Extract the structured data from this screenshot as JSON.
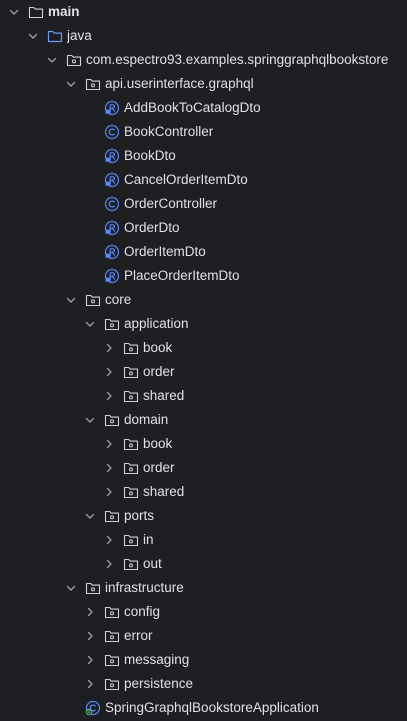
{
  "project_tree": {
    "nodes": [
      {
        "label": "main",
        "kind": "folder-plain",
        "state": "expanded",
        "bold": true,
        "depth": 0
      },
      {
        "label": "java",
        "kind": "folder-source",
        "state": "expanded",
        "depth": 1
      },
      {
        "label": "com.espectro93.examples.springgraphqlbookstore",
        "kind": "package",
        "state": "expanded",
        "depth": 2
      },
      {
        "label": "api.userinterface.graphql",
        "kind": "package",
        "state": "expanded",
        "depth": 3
      },
      {
        "label": "AddBookToCatalogDto",
        "kind": "record",
        "state": "leaf",
        "depth": 4
      },
      {
        "label": "BookController",
        "kind": "class",
        "state": "leaf",
        "depth": 4
      },
      {
        "label": "BookDto",
        "kind": "record",
        "state": "leaf",
        "depth": 4
      },
      {
        "label": "CancelOrderItemDto",
        "kind": "record",
        "state": "leaf",
        "depth": 4
      },
      {
        "label": "OrderController",
        "kind": "class",
        "state": "leaf",
        "depth": 4
      },
      {
        "label": "OrderDto",
        "kind": "record",
        "state": "leaf",
        "depth": 4
      },
      {
        "label": "OrderItemDto",
        "kind": "record",
        "state": "leaf",
        "depth": 4
      },
      {
        "label": "PlaceOrderItemDto",
        "kind": "record",
        "state": "leaf",
        "depth": 4
      },
      {
        "label": "core",
        "kind": "package",
        "state": "expanded",
        "depth": 3
      },
      {
        "label": "application",
        "kind": "package",
        "state": "expanded",
        "depth": 4
      },
      {
        "label": "book",
        "kind": "package",
        "state": "collapsed",
        "depth": 5
      },
      {
        "label": "order",
        "kind": "package",
        "state": "collapsed",
        "depth": 5
      },
      {
        "label": "shared",
        "kind": "package",
        "state": "collapsed",
        "depth": 5
      },
      {
        "label": "domain",
        "kind": "package",
        "state": "expanded",
        "depth": 4
      },
      {
        "label": "book",
        "kind": "package",
        "state": "collapsed",
        "depth": 5
      },
      {
        "label": "order",
        "kind": "package",
        "state": "collapsed",
        "depth": 5
      },
      {
        "label": "shared",
        "kind": "package",
        "state": "collapsed",
        "depth": 5
      },
      {
        "label": "ports",
        "kind": "package",
        "state": "expanded",
        "depth": 4
      },
      {
        "label": "in",
        "kind": "package",
        "state": "collapsed",
        "depth": 5
      },
      {
        "label": "out",
        "kind": "package",
        "state": "collapsed",
        "depth": 5
      },
      {
        "label": "infrastructure",
        "kind": "package",
        "state": "expanded",
        "depth": 3
      },
      {
        "label": "config",
        "kind": "package",
        "state": "collapsed",
        "depth": 4
      },
      {
        "label": "error",
        "kind": "package",
        "state": "collapsed",
        "depth": 4
      },
      {
        "label": "messaging",
        "kind": "package",
        "state": "collapsed",
        "depth": 4
      },
      {
        "label": "persistence",
        "kind": "package",
        "state": "collapsed",
        "depth": 4
      },
      {
        "label": "SpringGraphqlBookstoreApplication",
        "kind": "spring-app-class",
        "state": "leaf",
        "depth": 3
      }
    ]
  },
  "colors": {
    "background": "#1e1f22",
    "text": "#dfe1e5",
    "chevron": "#9da0a8",
    "folder_outline": "#ced0d6",
    "source_folder": "#6b9bfa",
    "class_icon": "#548af7",
    "spring_icon": "#5fb865"
  },
  "icons": {
    "expanded": "chevron-down-icon",
    "collapsed": "chevron-right-icon",
    "folder-plain": "folder-icon",
    "folder-source": "source-folder-icon",
    "package": "package-icon",
    "class": "class-icon",
    "record": "record-icon",
    "spring-app-class": "spring-boot-class-icon"
  }
}
